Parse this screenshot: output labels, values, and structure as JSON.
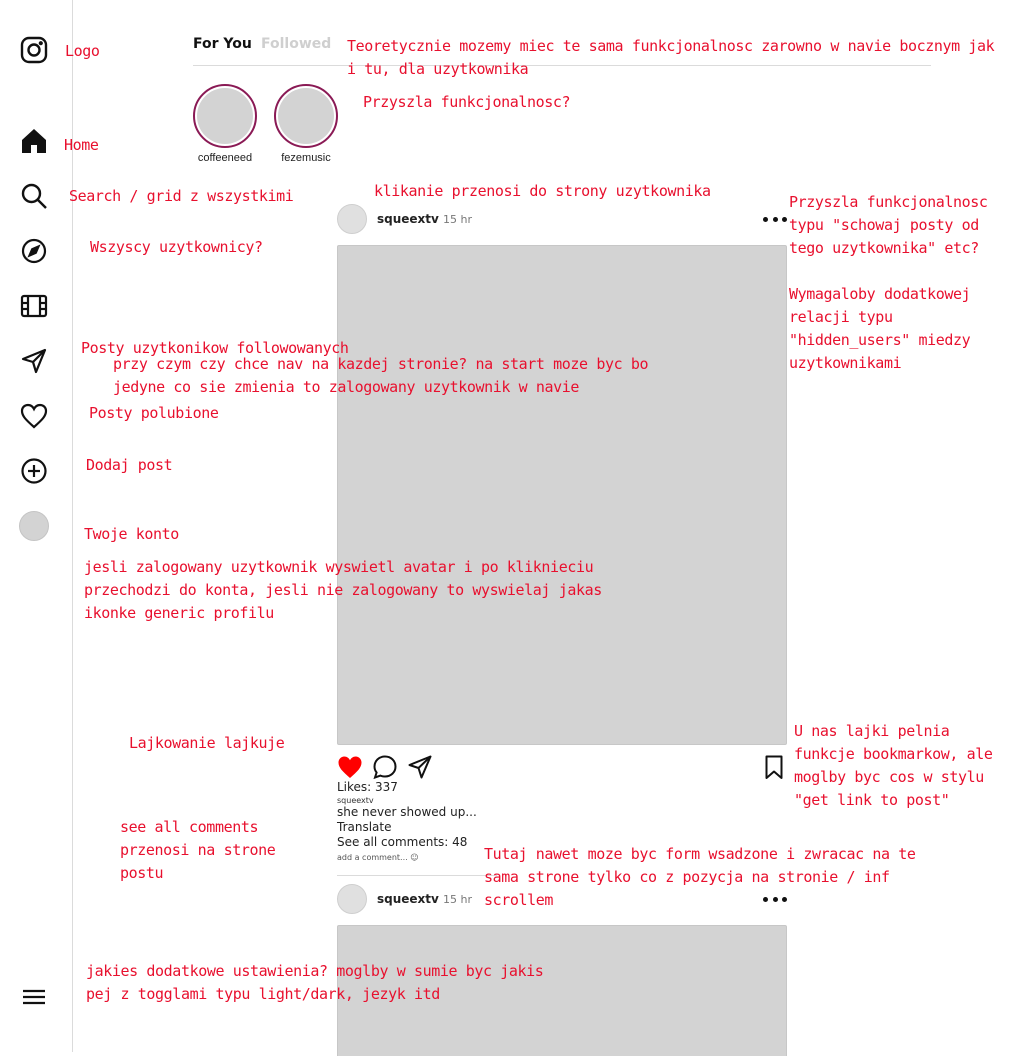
{
  "sidebar": {
    "items": [
      {
        "icon": "instagram-logo-icon"
      },
      {
        "icon": "home-icon"
      },
      {
        "icon": "search-icon"
      },
      {
        "icon": "explore-compass-icon"
      },
      {
        "icon": "reels-film-icon"
      },
      {
        "icon": "send-direct-icon"
      },
      {
        "icon": "heart-icon"
      },
      {
        "icon": "add-post-icon"
      },
      {
        "icon": "profile-avatar"
      },
      {
        "icon": "hamburger-menu-icon"
      }
    ]
  },
  "notes": {
    "logo": "Logo",
    "home": "Home",
    "search": "Search / grid z wszystkimi",
    "explore": "Wszyscy uzytkownicy?",
    "followed_posts": "Posty uzytkonikow followowanych",
    "nav_question": "przy czym czy chce nav na kazdej stronie? na start moze byc bo jedyne co sie zmienia to zalogowany uzytkownik w navie",
    "liked_posts": "Posty polubione",
    "add_post": "Dodaj post",
    "account": "Twoje konto",
    "account_note": "jesli zalogowany uzytkownik wyswietl avatar i po kliknieciu przechodzi do konta, jesli nie zalogowany to wyswielaj jakas ikonke generic profilu",
    "liking": "Lajkowanie lajkuje",
    "see_all_comments": "see all comments przenosi na strone postu",
    "settings": "jakies dodatkowe ustawienia? moglby w sumie byc jakis pej z togglami typu light/dark, jezyk itd",
    "tabs_note": "Teoretycznie mozemy miec te sama funkcjonalnosc zarowno w navie bocznym jak i tu, dla uzytkownika",
    "stories_note": "Przyszla funkcjonalnosc?",
    "user_click": "klikanie przenosi do strony uzytkownika",
    "hide_posts": "Przyszla funkcjonalnosc typu \"schowaj posty od tego uzytkownika\" etc?",
    "hidden_users": "Wymagaloby dodatkowej relacji typu \"hidden_users\" miedzy uzytkownikami",
    "bookmarks": "U nas lajki pelnia funkcje bookmarkow, ale moglby byc cos w stylu \"get link to post\"",
    "comment_form": "Tutaj nawet moze byc form wsadzone i zwracac na te sama strone tylko co z pozycja na stronie / inf scrollem"
  },
  "tabs": {
    "for_you": "For You",
    "followed": "Followed"
  },
  "stories": [
    {
      "name": "coffeeneed"
    },
    {
      "name": "fezemusic"
    }
  ],
  "posts": [
    {
      "username": "squeextv",
      "time": "15 hr",
      "likes": "Likes: 337",
      "caption_user": "squeextv",
      "caption": "she never showed up...",
      "translate": "Translate",
      "see_all": "See all comments: 48",
      "add_comment": "add a comment... ☺"
    },
    {
      "username": "squeextv",
      "time": "15 hr"
    }
  ],
  "colors": {
    "annotation": "#e8102e",
    "like_active": "#ff0000",
    "story_ring": "#8a1a55",
    "placeholder": "#d3d3d3"
  }
}
